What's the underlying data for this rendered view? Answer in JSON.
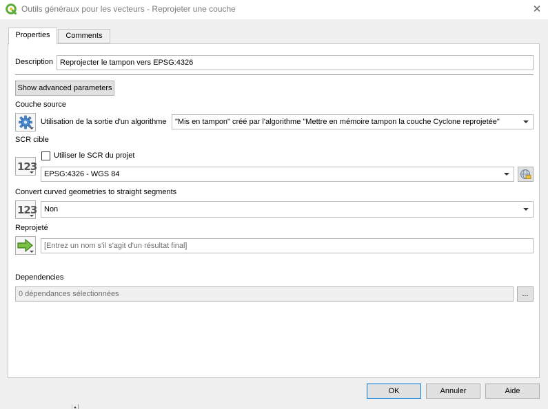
{
  "window": {
    "title": "Outils généraux pour les vecteurs - Reprojeter une couche",
    "logo_icon": "qgis-logo-icon",
    "close_label": "✕"
  },
  "tabs": [
    {
      "label": "Properties",
      "active": true
    },
    {
      "label": "Comments",
      "active": false
    }
  ],
  "description": {
    "label": "Description",
    "value": "Reprojecter le tampon vers EPSG:4326"
  },
  "advanced_button": "Show advanced parameters",
  "couche_source": {
    "label": "Couche source",
    "mode_label": "Utilisation de la sortie d'un algorithme",
    "value": "\"Mis en tampon\" créé par l'algorithme \"Mettre en mémoire tampon la couche Cyclone reprojetée\"",
    "icon": "algorithm-gear-icon"
  },
  "scr_cible": {
    "label": "SCR cible",
    "checkbox_label": "Utiliser le SCR du projet",
    "checked": false,
    "value": "EPSG:4326 - WGS 84",
    "icon_text": "123",
    "crs_button_icon": "crs-globe-icon"
  },
  "curved": {
    "label": "Convert curved geometries to straight segments",
    "value": "Non",
    "icon_text": "123"
  },
  "reprojete": {
    "label": "Reprojeté",
    "placeholder": "[Entrez un nom s'il s'agit d'un résultat final]",
    "icon": "output-arrow-icon"
  },
  "dependencies": {
    "label": "Dependencies",
    "value": "0 dépendances sélectionnées",
    "browse_label": "..."
  },
  "buttons": {
    "ok": "OK",
    "cancel": "Annuler",
    "help": "Aide"
  },
  "colors": {
    "accent": "#0078d7",
    "panel_bg": "#ffffff",
    "dialog_bg": "#f0f0f0",
    "qgis_green": "#5aad3b"
  }
}
